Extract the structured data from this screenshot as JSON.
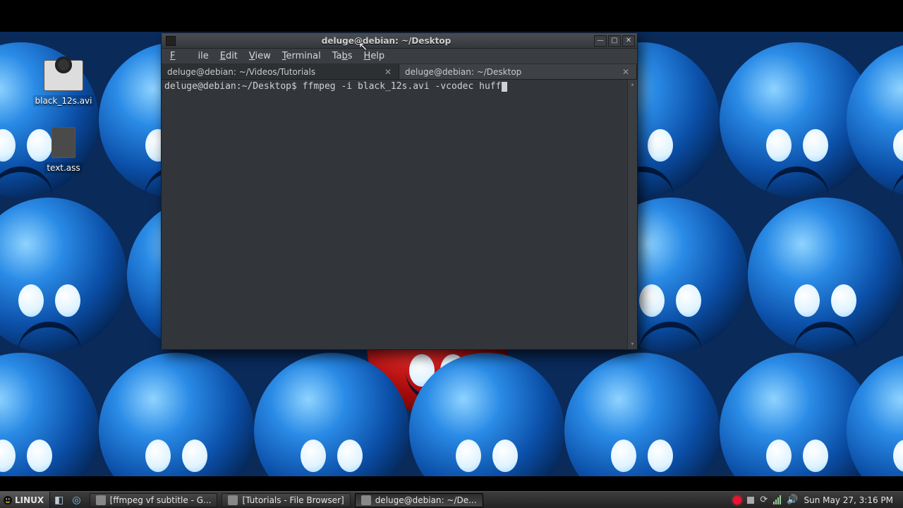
{
  "desktop_icons": {
    "video_file": "black_12s.avi",
    "text_file": "text.ass"
  },
  "terminal": {
    "title": "deluge@debian: ~/Desktop",
    "menu": {
      "file": "File",
      "edit": "Edit",
      "view": "View",
      "terminal": "Terminal",
      "tabs": "Tabs",
      "help": "Help"
    },
    "tabs": [
      {
        "label": "deluge@debian: ~/Videos/Tutorials",
        "active": false
      },
      {
        "label": "deluge@debian: ~/Desktop",
        "active": true
      }
    ],
    "prompt": "deluge@debian:~/Desktop$ ",
    "command": "ffmpeg -i black_12s.avi -vcodec huff"
  },
  "taskbar": {
    "start_label": "LINUX",
    "buttons": [
      {
        "label": "[ffmpeg vf subtitle - G...",
        "active": false
      },
      {
        "label": "[Tutorials - File Browser]",
        "active": false
      },
      {
        "label": "deluge@debian: ~/De...",
        "active": true
      }
    ],
    "clock": "Sun May 27,  3:16 PM"
  }
}
